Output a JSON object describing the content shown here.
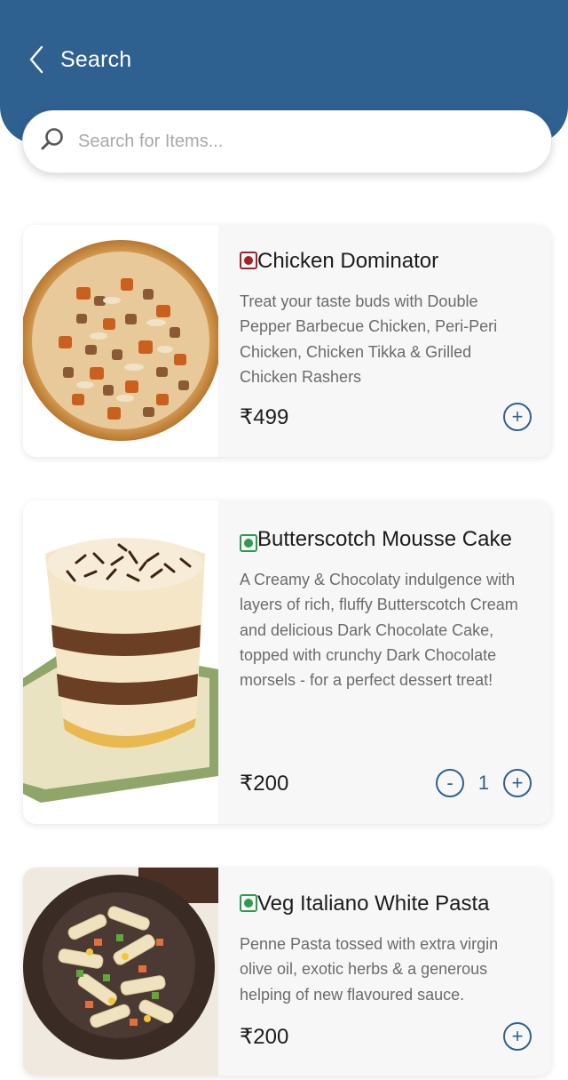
{
  "header": {
    "back_label": "Search"
  },
  "search": {
    "placeholder": "Search for Items..."
  },
  "items": [
    {
      "name": "Chicken Dominator",
      "type": "non-veg",
      "description": "Treat your taste buds with Double Pepper Barbecue Chicken, Peri-Peri Chicken, Chicken Tikka & Grilled Chicken Rashers",
      "price": "₹499"
    },
    {
      "name": "Butterscotch Mousse Cake",
      "type": "veg",
      "description": "A Creamy & Chocolaty indulgence with layers of rich, fluffy Butterscotch Cream and delicious Dark Chocolate Cake, topped with crunchy Dark Chocolate morsels - for a perfect dessert treat!",
      "price": "₹200",
      "quantity": "1"
    },
    {
      "name": "Veg Italiano White Pasta",
      "type": "veg",
      "description": "Penne Pasta tossed with extra virgin olive oil, exotic herbs & a generous helping of new flavoured sauce.",
      "price": "₹200"
    }
  ],
  "icons": {
    "back": "chevron-left-icon",
    "search": "search-icon",
    "add": "plus-circle-icon",
    "remove": "minus-circle-icon"
  },
  "colors": {
    "header": "#2f6190",
    "accent": "#2f6190",
    "veg": "#2f9a4f",
    "non_veg": "#a0252a"
  }
}
